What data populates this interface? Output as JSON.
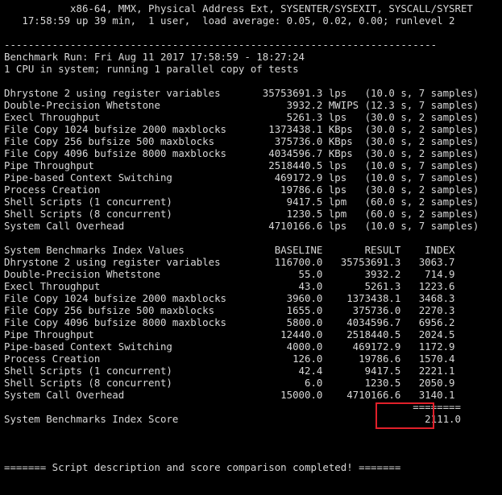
{
  "terminal": {
    "header": [
      "           x86-64, MMX, Physical Address Ext, SYSENTER/SYSEXIT, SYSCALL/SYSRET",
      "   17:58:59 up 39 min,  1 user,  load average: 0.05, 0.02, 0.00; runlevel 2"
    ],
    "separator": "------------------------------------------------------------------------",
    "run_info": [
      "Benchmark Run: Fri Aug 11 2017 17:58:59 - 18:27:24",
      "1 CPU in system; running 1 parallel copy of tests"
    ],
    "results": [
      "Dhrystone 2 using register variables       35753691.3 lps   (10.0 s, 7 samples)",
      "Double-Precision Whetstone                     3932.2 MWIPS (12.3 s, 7 samples)",
      "Execl Throughput                               5261.3 lps   (30.0 s, 2 samples)",
      "File Copy 1024 bufsize 2000 maxblocks       1373438.1 KBps  (30.0 s, 2 samples)",
      "File Copy 256 bufsize 500 maxblocks          375736.0 KBps  (30.0 s, 2 samples)",
      "File Copy 4096 bufsize 8000 maxblocks       4034596.7 KBps  (30.0 s, 2 samples)",
      "Pipe Throughput                             2518440.5 lps   (10.0 s, 7 samples)",
      "Pipe-based Context Switching                 469172.9 lps   (10.0 s, 7 samples)",
      "Process Creation                              19786.6 lps   (30.0 s, 2 samples)",
      "Shell Scripts (1 concurrent)                   9417.5 lpm   (60.0 s, 2 samples)",
      "Shell Scripts (8 concurrent)                   1230.5 lpm   (60.0 s, 2 samples)",
      "System Call Overhead                        4710166.6 lps   (10.0 s, 7 samples)"
    ],
    "index_header": "System Benchmarks Index Values               BASELINE       RESULT    INDEX",
    "index_rows": [
      "Dhrystone 2 using register variables         116700.0   35753691.3   3063.7",
      "Double-Precision Whetstone                       55.0       3932.2    714.9",
      "Execl Throughput                                 43.0       5261.3   1223.6",
      "File Copy 1024 bufsize 2000 maxblocks          3960.0    1373438.1   3468.3",
      "File Copy 256 bufsize 500 maxblocks            1655.0     375736.0   2270.3",
      "File Copy 4096 bufsize 8000 maxblocks          5800.0    4034596.7   6956.2",
      "Pipe Throughput                               12440.0    2518440.5   2024.5",
      "Pipe-based Context Switching                   4000.0     469172.9   1172.9",
      "Process Creation                                126.0      19786.6   1570.4",
      "Shell Scripts (1 concurrent)                     42.4       9417.5   2221.1",
      "Shell Scripts (8 concurrent)                      6.0       1230.5   2050.9",
      "System Call Overhead                          15000.0    4710166.6   3140.1"
    ],
    "score_separator": "                                                                    ========",
    "score_line": "System Benchmarks Index Score                                         2111.0",
    "footer": "======= Script description and score comparison completed! ======="
  }
}
